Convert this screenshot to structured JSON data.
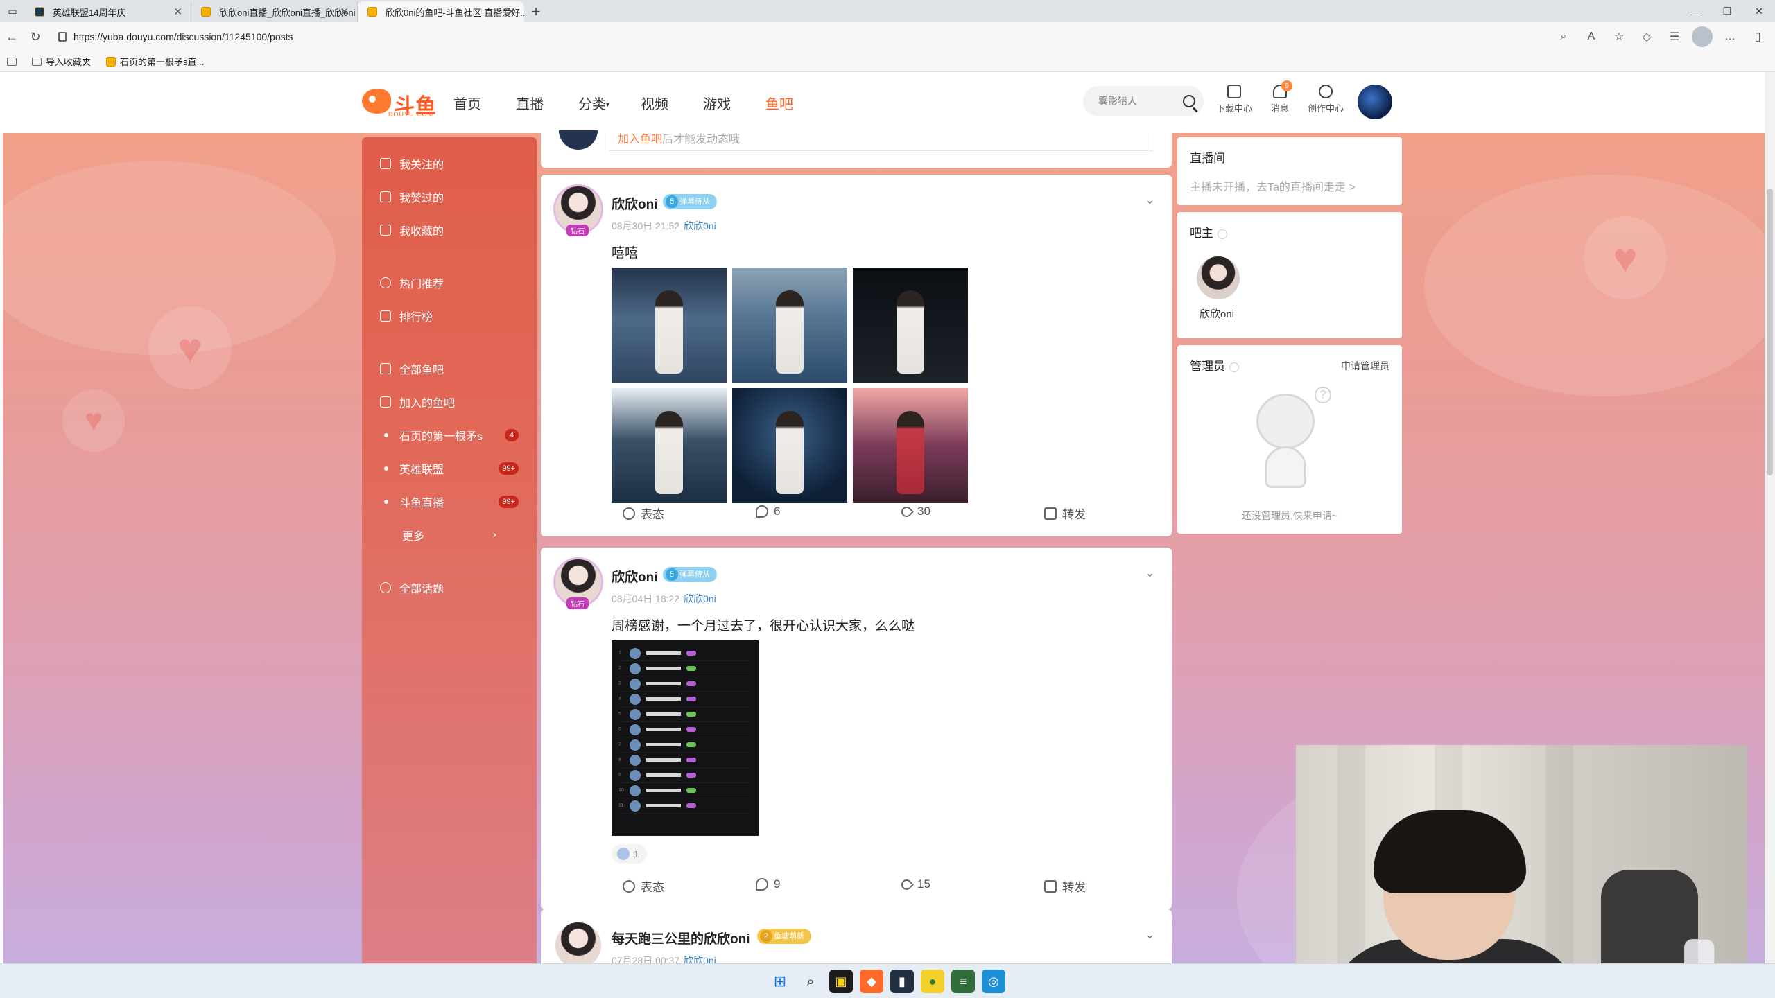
{
  "browser": {
    "tabs": [
      {
        "title": "英雄联盟14周年庆",
        "active": false
      },
      {
        "title": "欣欣oni直播_欣欣oni直播_欣欣oni",
        "active": false
      },
      {
        "title": "欣欣0ni的鱼吧-斗鱼社区,直播爱好...",
        "active": true
      }
    ],
    "url": "https://yuba.douyu.com/discussion/11245100/posts",
    "bookmarks": [
      "导入收藏夹",
      "石页的第一根矛s直..."
    ]
  },
  "header": {
    "logo_text": "斗鱼",
    "logo_sub": "DOUYU.COM",
    "nav": [
      "首页",
      "直播",
      "分类",
      "视频",
      "游戏",
      "鱼吧"
    ],
    "active_nav": "鱼吧",
    "search_placeholder": "雾影猎人",
    "tools": [
      {
        "label": "下载中心",
        "icon": "download-icon"
      },
      {
        "label": "消息",
        "icon": "bell-icon",
        "badge": "9"
      },
      {
        "label": "创作中心",
        "icon": "bulb-icon"
      }
    ]
  },
  "left_menu": {
    "group1": [
      "我关注的",
      "我赞过的",
      "我收藏的"
    ],
    "group2": [
      "热门推荐",
      "排行榜"
    ],
    "group3": [
      "全部鱼吧",
      "加入的鱼吧"
    ],
    "joined": [
      {
        "name": "石页的第一根矛s",
        "count": "4"
      },
      {
        "name": "英雄联盟",
        "count": "99+"
      },
      {
        "name": "斗鱼直播",
        "count": "99+"
      }
    ],
    "more": "更多",
    "topics": "全部话题"
  },
  "feed": {
    "join_prompt": {
      "link": "加入鱼吧",
      "rest": "后才能发动态哦"
    },
    "posts": [
      {
        "author": "欣欣oni",
        "level": "5",
        "level_label": "弹幕侍从",
        "avatar_tag": "钻石",
        "time": "08月30日 21:52",
        "bar": "欣欣0ni",
        "text": "嘻嘻",
        "actions": {
          "react": "表态",
          "comments": "6",
          "likes": "30",
          "share": "转发"
        }
      },
      {
        "author": "欣欣oni",
        "level": "5",
        "level_label": "弹幕侍从",
        "avatar_tag": "钻石",
        "time": "08月04日 18:22",
        "bar": "欣欣0ni",
        "text": "周榜感谢，一个月过去了，很开心认识大家，么么哒",
        "reaction_count": "1",
        "actions": {
          "react": "表态",
          "comments": "9",
          "likes": "15",
          "share": "转发"
        }
      },
      {
        "author": "每天跑三公里的欣欣oni",
        "level": "2",
        "level_label": "鱼塘萌新",
        "time": "07月28日 00:37",
        "bar": "欣欣0ni"
      }
    ]
  },
  "sidebar": {
    "live_room": {
      "title": "直播间",
      "status": "主播未开播，去Ta的直播间走走 >"
    },
    "owner": {
      "title": "吧主",
      "name": "欣欣oni"
    },
    "admins": {
      "title": "管理员",
      "apply": "申请管理员",
      "empty": "还没管理员,快来申请~"
    }
  }
}
